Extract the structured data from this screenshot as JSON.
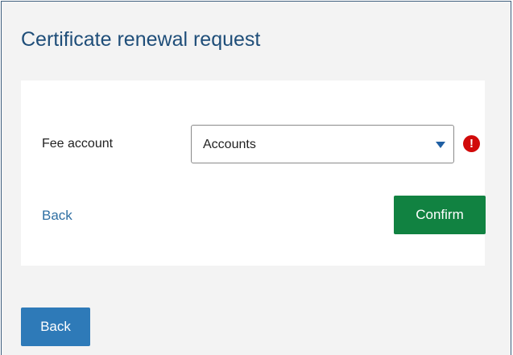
{
  "page": {
    "title": "Certificate renewal request"
  },
  "form": {
    "fee_account_label": "Fee account",
    "fee_account_value": "Accounts",
    "error_icon": "!",
    "back_link_label": "Back",
    "confirm_label": "Confirm"
  },
  "footer": {
    "back_button_label": "Back"
  },
  "icons": {
    "dropdown": "chevron-down-icon",
    "error": "error-icon"
  },
  "colors": {
    "title": "#1f4e79",
    "confirm": "#118241",
    "back_button": "#2e7ab8",
    "error": "#d10a0a",
    "link": "#2f6fa3"
  }
}
